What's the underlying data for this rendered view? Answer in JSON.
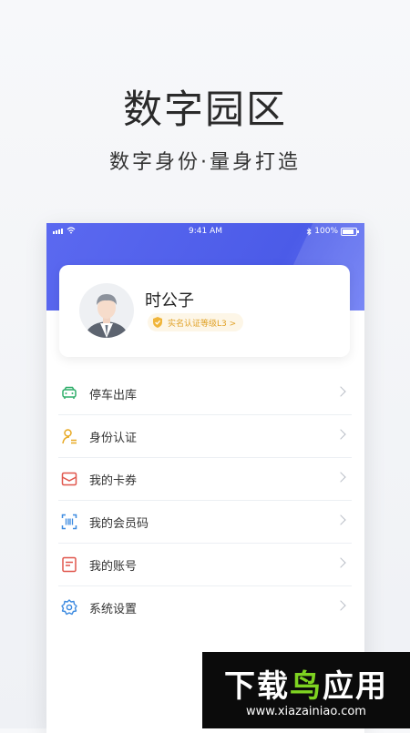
{
  "promo": {
    "headline": "数字园区",
    "subline": "数字身份·量身打造"
  },
  "status_bar": {
    "time": "9:41 AM",
    "battery": "100%"
  },
  "profile": {
    "name": "时公子",
    "cert_badge": "实名认证等级L3 >"
  },
  "menu": {
    "items": [
      {
        "label": "停车出库",
        "icon": "car-icon",
        "color": "#2fae6a"
      },
      {
        "label": "身份认证",
        "icon": "identity-icon",
        "color": "#e8a924"
      },
      {
        "label": "我的卡券",
        "icon": "coupon-icon",
        "color": "#e0564c"
      },
      {
        "label": "我的会员码",
        "icon": "qr-code-icon",
        "color": "#3c8ae0"
      },
      {
        "label": "我的账号",
        "icon": "account-icon",
        "color": "#e0564c"
      },
      {
        "label": "系统设置",
        "icon": "settings-gear-icon",
        "color": "#3c8ae0"
      }
    ]
  },
  "watermark": {
    "title_white_1": "下载",
    "title_green": "鸟",
    "title_white_2": "应用",
    "url": "www.xiazainiao.com"
  }
}
